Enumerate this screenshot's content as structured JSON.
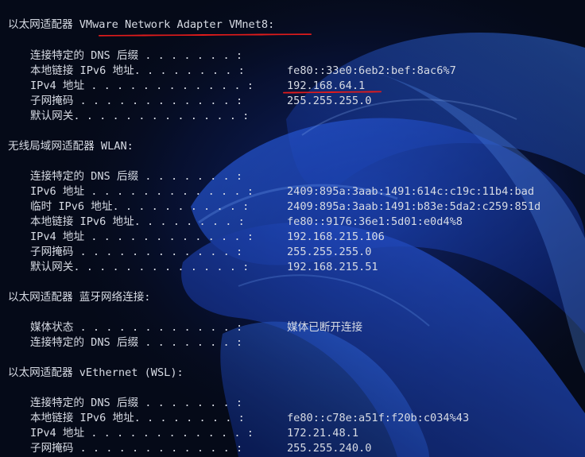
{
  "terminal": {
    "sections": [
      {
        "header": "以太网适配器 VMware Network Adapter VMnet8:",
        "entries": [
          {
            "label": "连接特定的 DNS 后缀 . . . . . . . :",
            "value": ""
          },
          {
            "label": "本地链接 IPv6 地址. . . . . . . . :",
            "value": "fe80::33e0:6eb2:bef:8ac6%7"
          },
          {
            "label": "IPv4 地址 . . . . . . . . . . . . :",
            "value": "192.168.64.1"
          },
          {
            "label": "子网掩码 . . . . . . . . . . . . :",
            "value": "255.255.255.0"
          },
          {
            "label": "默认网关. . . . . . . . . . . . . :",
            "value": ""
          }
        ]
      },
      {
        "header": "无线局域网适配器 WLAN:",
        "entries": [
          {
            "label": "连接特定的 DNS 后缀 . . . . . . . :",
            "value": ""
          },
          {
            "label": "IPv6 地址 . . . . . . . . . . . . :",
            "value": "2409:895a:3aab:1491:614c:c19c:11b4:bad"
          },
          {
            "label": "临时 IPv6 地址. . . . . . . . . . :",
            "value": "2409:895a:3aab:1491:b83e:5da2:c259:851d"
          },
          {
            "label": "本地链接 IPv6 地址. . . . . . . . :",
            "value": "fe80::9176:36e1:5d01:e0d4%8"
          },
          {
            "label": "IPv4 地址 . . . . . . . . . . . . :",
            "value": "192.168.215.106"
          },
          {
            "label": "子网掩码 . . . . . . . . . . . . :",
            "value": "255.255.255.0"
          },
          {
            "label": "默认网关. . . . . . . . . . . . . :",
            "value": "192.168.215.51"
          }
        ]
      },
      {
        "header": "以太网适配器 蓝牙网络连接:",
        "entries": [
          {
            "label": "媒体状态 . . . . . . . . . . . . :",
            "value": "媒体已断开连接"
          },
          {
            "label": "连接特定的 DNS 后缀 . . . . . . . :",
            "value": ""
          }
        ]
      },
      {
        "header": "以太网适配器 vEthernet (WSL):",
        "entries": [
          {
            "label": "连接特定的 DNS 后缀 . . . . . . . :",
            "value": ""
          },
          {
            "label": "本地链接 IPv6 地址. . . . . . . . :",
            "value": "fe80::c78e:a51f:f20b:c034%43"
          },
          {
            "label": "IPv4 地址 . . . . . . . . . . . . :",
            "value": "172.21.48.1"
          },
          {
            "label": "子网掩码 . . . . . . . . . . . . :",
            "value": "255.255.240.0"
          }
        ]
      }
    ]
  },
  "colors": {
    "text": "#d7dbe4",
    "annotation": "#e11b1b",
    "background": "#050a18",
    "wallpaper_accent": "#1d4fe0"
  }
}
